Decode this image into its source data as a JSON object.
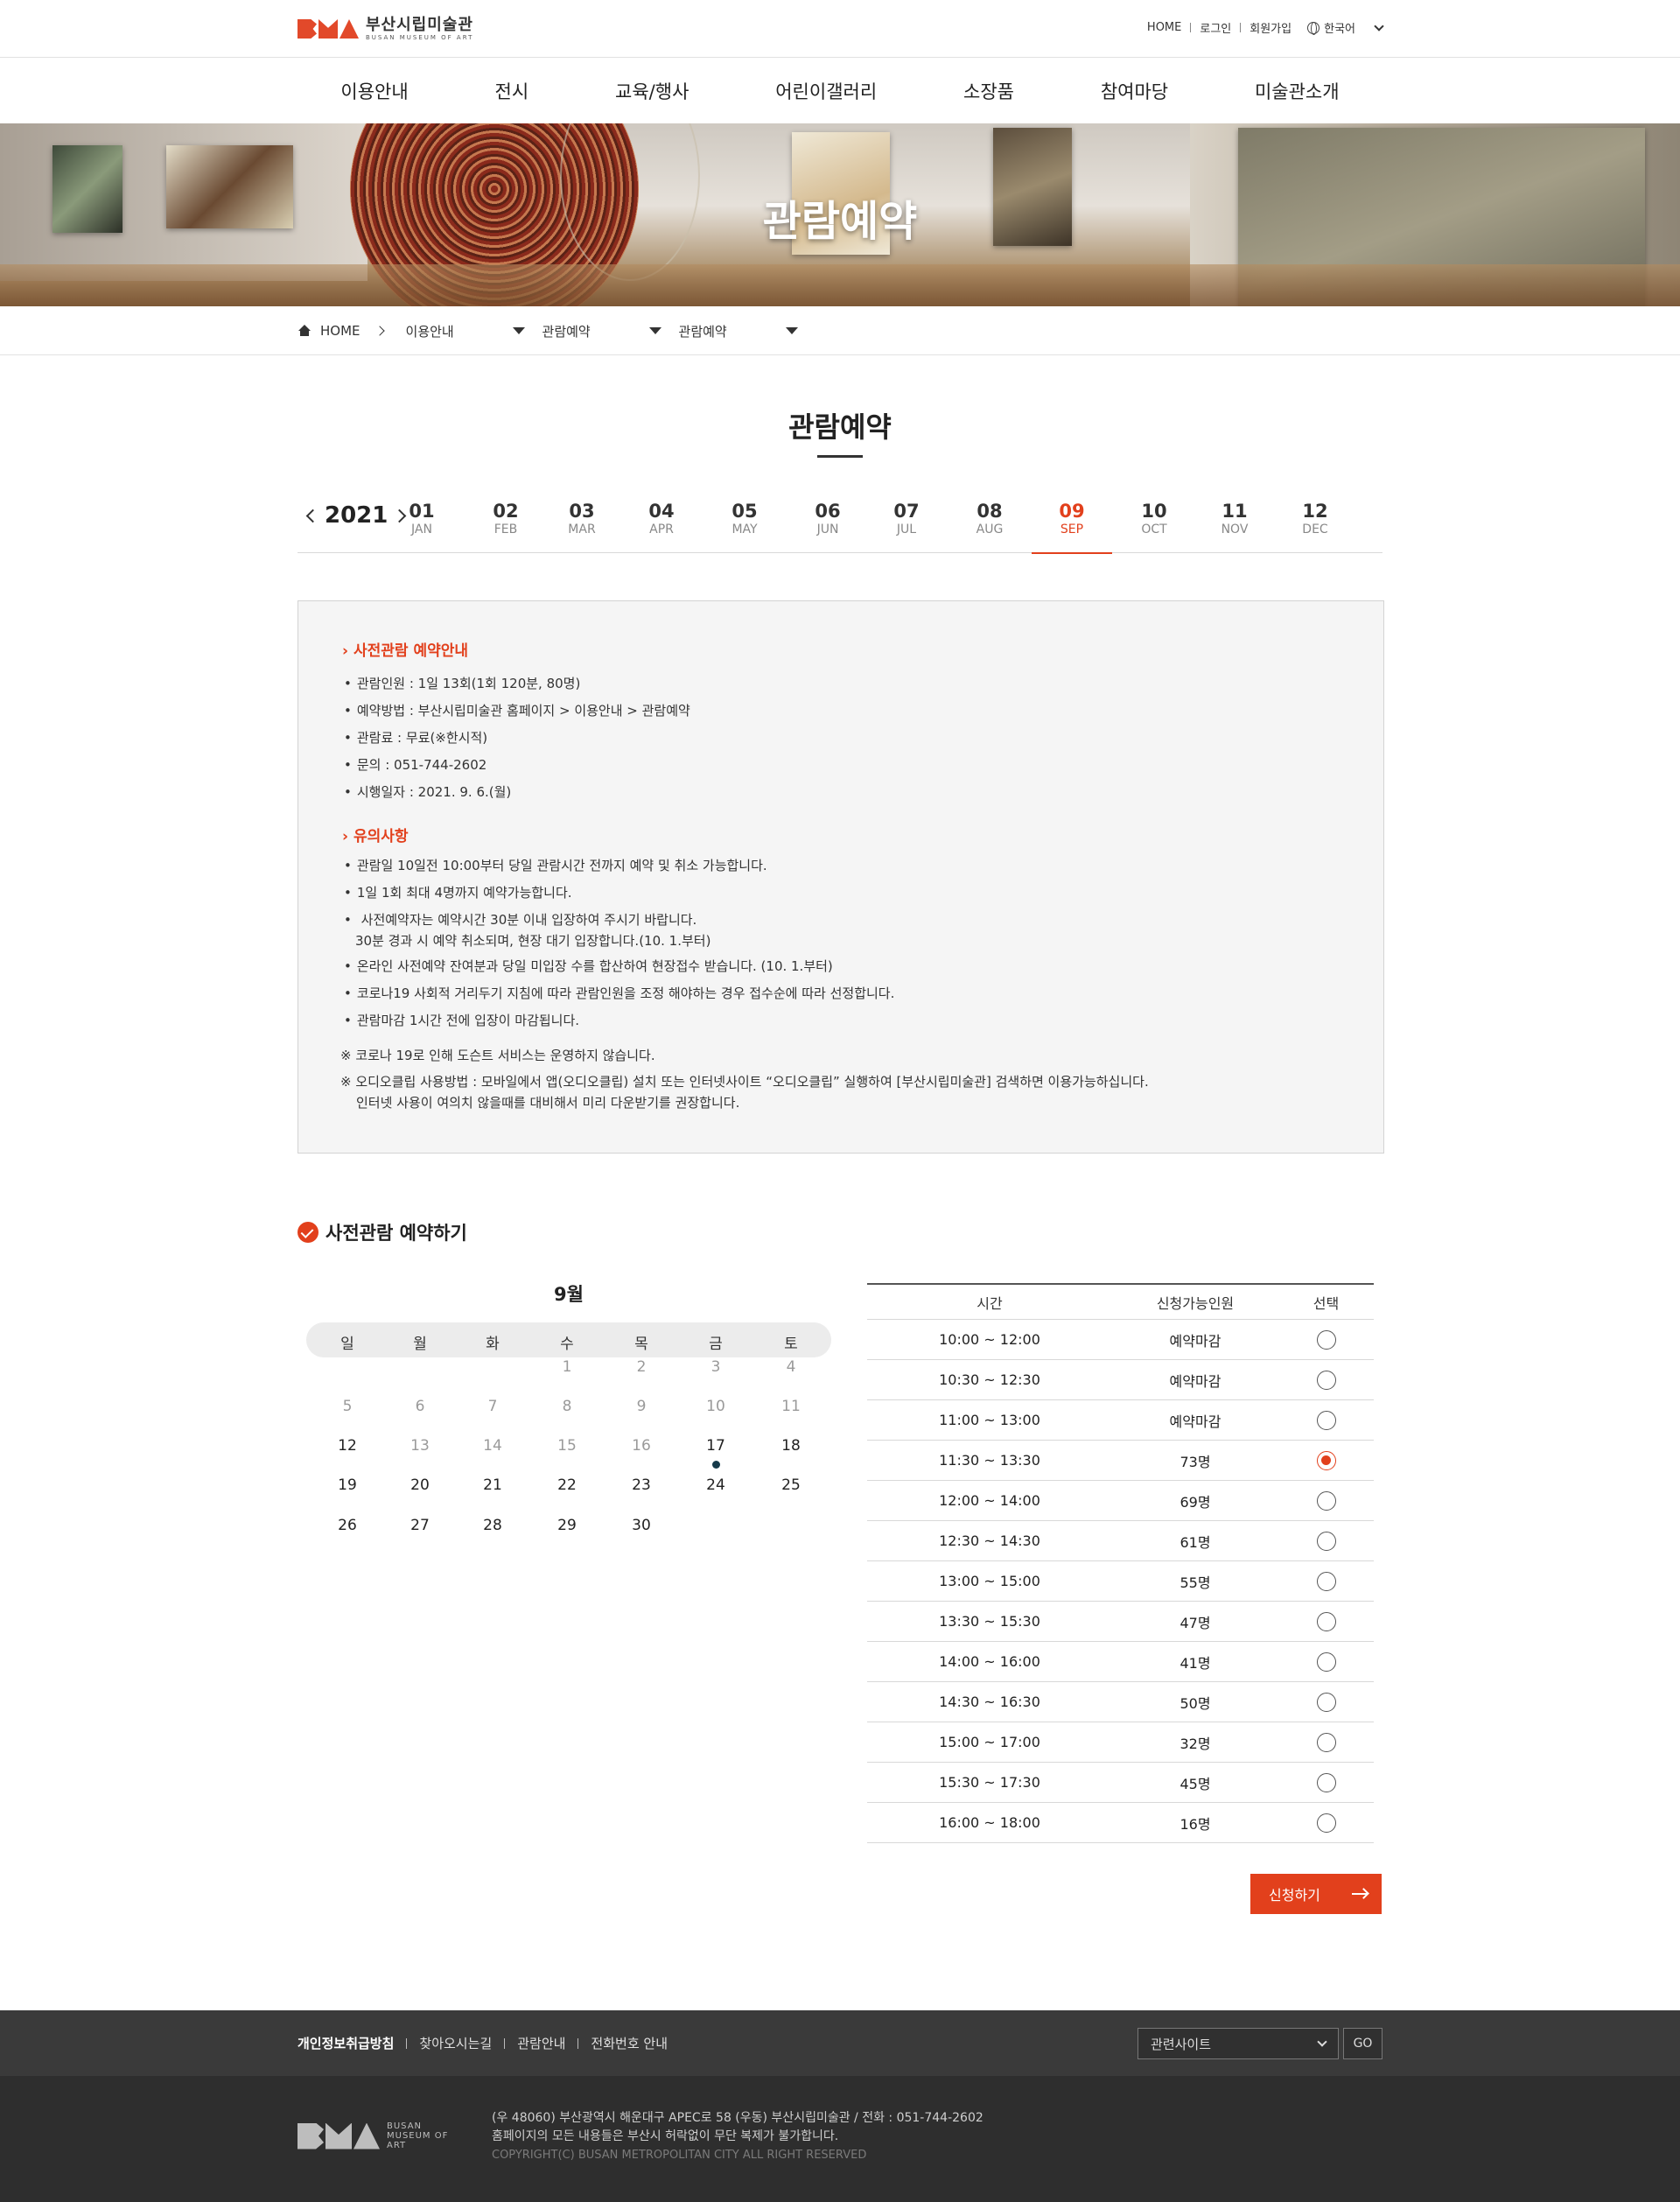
{
  "header": {
    "logo_ko": "부산시립미술관",
    "logo_en": "BUSAN MUSEUM OF ART",
    "util": [
      "HOME",
      "로그인",
      "회원가입"
    ],
    "lang": "한국어"
  },
  "gnb": [
    "이용안내",
    "전시",
    "교육/행사",
    "어린이갤러리",
    "소장품",
    "참여마당",
    "미술관소개"
  ],
  "hero": {
    "title": "관람예약"
  },
  "breadcrumb": {
    "home": "HOME",
    "level1": "이용안내",
    "level2": "관람예약",
    "level3": "관람예약"
  },
  "page_title": "관람예약",
  "months": {
    "year": "2021",
    "selected": "09",
    "items": [
      {
        "num": "01",
        "en": "JAN"
      },
      {
        "num": "02",
        "en": "FEB"
      },
      {
        "num": "03",
        "en": "MAR"
      },
      {
        "num": "04",
        "en": "APR"
      },
      {
        "num": "05",
        "en": "MAY"
      },
      {
        "num": "06",
        "en": "JUN"
      },
      {
        "num": "07",
        "en": "JUL"
      },
      {
        "num": "08",
        "en": "AUG"
      },
      {
        "num": "09",
        "en": "SEP"
      },
      {
        "num": "10",
        "en": "OCT"
      },
      {
        "num": "11",
        "en": "NOV"
      },
      {
        "num": "12",
        "en": "DEC"
      }
    ]
  },
  "info": {
    "sec1_title": "사전관람 예약안내",
    "sec1_items": [
      "관람인원 : 1일 13회(1회 120분, 80명)",
      "예약방법 : 부산시립미술관 홈페이지 > 이용안내 > 관람예약",
      "관람료 : 무료(※한시적)",
      "문의 : 051-744-2602",
      "시행일자 : 2021. 9. 6.(월)"
    ],
    "sec2_title": "유의사항",
    "sec2_items": [
      "관람일 10일전 10:00부터 당일 관람시간 전까지 예약 및 취소 가능합니다.",
      "1일 1회 최대 4명까지 예약가능합니다.",
      "사전예약자는 예약시간 30분 이내 입장하여 주시기 바랍니다.",
      "30분 경과 시 예약 취소되며, 현장 대기 입장합니다.(10. 1.부터)",
      "온라인 사전예약 잔여분과 당일 미입장 수를 합산하여 현장접수 받습니다. (10. 1.부터)",
      "코로나19 사회적 거리두기 지침에 따라 관람인원을 조정 해야하는 경우 접수순에 따라 선정합니다.",
      "관람마감 1시간 전에 입장이 마감됩니다."
    ],
    "note1": "※ 코로나 19로 인해 도슨트 서비스는 운영하지 않습니다.",
    "note2": "※ 오디오클립 사용방법 : 모바일에서 앱(오디오클립) 설치 또는 인터넷사이트 “오디오클립” 실행하여 [부산시립미술관] 검색하면 이용가능하십니다.",
    "note2_l2": "인터넷 사용이 여의치 않을때를 대비해서 미리 다운받기를 권장합니다."
  },
  "reservation": {
    "title": "사전관람 예약하기",
    "calendar": {
      "month_label": "9월",
      "weekdays": [
        "일",
        "월",
        "화",
        "수",
        "목",
        "금",
        "토"
      ],
      "weeks": [
        [
          "",
          "",
          "",
          "1",
          "2",
          "3",
          "4"
        ],
        [
          "5",
          "6",
          "7",
          "8",
          "9",
          "10",
          "11"
        ],
        [
          "12",
          "13",
          "14",
          "15",
          "16",
          "17",
          "18"
        ],
        [
          "19",
          "20",
          "21",
          "22",
          "23",
          "24",
          "25"
        ],
        [
          "26",
          "27",
          "28",
          "29",
          "30",
          "",
          ""
        ]
      ],
      "disabled": [
        "1",
        "2",
        "3",
        "4",
        "5",
        "6",
        "7",
        "8",
        "9",
        "10",
        "11",
        "13",
        "14",
        "15",
        "16"
      ],
      "selected_day": "17"
    },
    "table": {
      "headers": [
        "시간",
        "신청가능인원",
        "선택"
      ],
      "rows": [
        {
          "time": "10:00 ~ 12:00",
          "avail": "예약마감"
        },
        {
          "time": "10:30 ~ 12:30",
          "avail": "예약마감"
        },
        {
          "time": "11:00 ~ 13:00",
          "avail": "예약마감"
        },
        {
          "time": "11:30 ~ 13:30",
          "avail": "73명"
        },
        {
          "time": "12:00 ~ 14:00",
          "avail": "69명"
        },
        {
          "time": "12:30 ~ 14:30",
          "avail": "61명"
        },
        {
          "time": "13:00 ~ 15:00",
          "avail": "55명"
        },
        {
          "time": "13:30 ~ 15:30",
          "avail": "47명"
        },
        {
          "time": "14:00 ~ 16:00",
          "avail": "41명"
        },
        {
          "time": "14:30 ~ 16:30",
          "avail": "50명"
        },
        {
          "time": "15:00 ~ 17:00",
          "avail": "32명"
        },
        {
          "time": "15:30 ~ 17:30",
          "avail": "45명"
        },
        {
          "time": "16:00 ~ 18:00",
          "avail": "16명"
        }
      ],
      "selected_row": 3
    },
    "apply_label": "신청하기"
  },
  "footer": {
    "links": [
      "개인정보취급방침",
      "찾아오시는길",
      "관람안내",
      "전화번호 안내"
    ],
    "related_label": "관련사이트",
    "go_label": "GO",
    "logo_text": [
      "BUSAN",
      "MUSEUM OF",
      "ART"
    ],
    "address": "(우 48060) 부산광역시 해운대구 APEC로 58 (우동) 부산시립미술관 / 전화 : 051-744-2602",
    "notice": "홈페이지의 모든 내용들은 부산시 허락없이 무단 복제가 불가합니다.",
    "copyright": "COPYRIGHT(C) BUSAN METROPOLITAN CITY ALL RIGHT RESERVED"
  },
  "colors": {
    "accent": "#e2401c",
    "footer_top": "#3a3a3a",
    "footer_bottom": "#2e2e2e"
  }
}
